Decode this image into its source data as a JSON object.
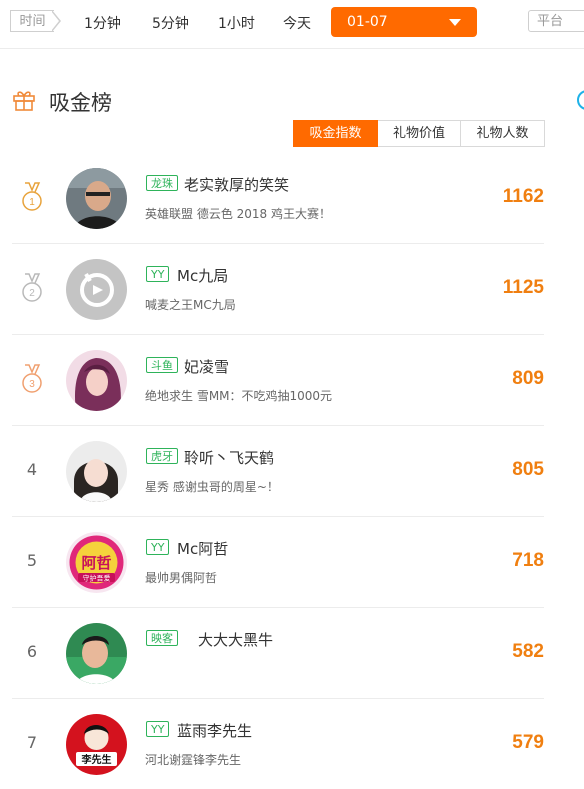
{
  "filters": {
    "time_label": "时间",
    "ranges": [
      "1分钟",
      "5分钟",
      "1小时",
      "今天"
    ],
    "date_value": "01-07",
    "platform_label": "平台"
  },
  "section": {
    "title": "吸金榜",
    "sort_tabs": [
      "吸金指数",
      "礼物价值",
      "礼物人数"
    ],
    "active_tab": "吸金指数"
  },
  "rankings": [
    {
      "rank": "1",
      "platform": "龙珠",
      "name": "老实敦厚的笑笑",
      "desc": "英雄联盟 德云色 2018 鸡王大赛！",
      "score": "1162"
    },
    {
      "rank": "2",
      "platform": "YY",
      "name": "Mc九局",
      "desc": "喊麦之王MC九局",
      "score": "1125"
    },
    {
      "rank": "3",
      "platform": "斗鱼",
      "name": "妃凌雪",
      "desc": "绝地求生 雪MM：不吃鸡抽1000元",
      "score": "809"
    },
    {
      "rank": "4",
      "platform": "虎牙",
      "name": "聆听丶飞天鹤",
      "desc": "星秀 感谢虫哥的周星~！",
      "score": "805"
    },
    {
      "rank": "5",
      "platform": "YY",
      "name": "Mc阿哲",
      "desc": "最帅男偶阿哲",
      "score": "718"
    },
    {
      "rank": "6",
      "platform": "映客",
      "name": "大大大黑牛",
      "desc": "",
      "score": "582"
    },
    {
      "rank": "7",
      "platform": "YY",
      "name": "蓝雨李先生",
      "desc": "河北谢霆锋李先生",
      "score": "579"
    }
  ],
  "avatar_text": {
    "row5_big": "阿哲",
    "row5_small": "守护吾爱",
    "row7": "李先生"
  },
  "colors": {
    "accent": "#ff6a00",
    "score": "#f07f10",
    "platform_badge": "#2eb35a",
    "gold_medal": "#e8a33c",
    "silver_medal": "#b9b9b9",
    "bronze_medal": "#f0a070"
  },
  "icons": {
    "header": "gift-icon",
    "date_select": "chevron-down-icon",
    "medals": [
      "gold-medal-icon",
      "silver-medal-icon",
      "bronze-medal-icon"
    ]
  }
}
